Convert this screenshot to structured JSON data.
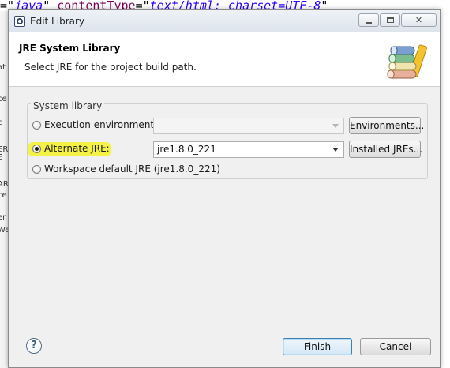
{
  "background": {
    "code_line": {
      "segments": [
        {
          "text": "=\"",
          "cls": "pl"
        },
        {
          "text": "java",
          "cls": "str"
        },
        {
          "text": "\" ",
          "cls": "pl"
        },
        {
          "text": "contentType",
          "cls": "kw"
        },
        {
          "text": "=\"",
          "cls": "pl"
        },
        {
          "text": "text/html; charset=UTF-8",
          "cls": "str"
        },
        {
          "text": "\"",
          "cls": "pl"
        }
      ]
    },
    "side_fragments": [
      "at",
      "ce",
      "c",
      "ER",
      "E",
      "AR",
      "ce",
      "er",
      "We"
    ]
  },
  "dialog": {
    "title": "Edit Library",
    "window_buttons": {
      "minimize": "minimize",
      "maximize": "maximize",
      "close": "✕"
    },
    "header": {
      "title": "JRE System Library",
      "description": "Select JRE for the project build path.",
      "icon": "library-books-icon"
    },
    "group": {
      "label": "System library",
      "options": [
        {
          "label": "Execution environment:",
          "selected": false
        },
        {
          "label": "Alternate JRE:",
          "selected": true
        },
        {
          "label": "Workspace default JRE (jre1.8.0_221)",
          "selected": false
        }
      ],
      "execution_env_value": "",
      "alternate_jre_value": "jre1.8.0_221",
      "environments_button": "Environments...",
      "installed_jres_button": "Installed JREs..."
    },
    "footer": {
      "help_icon": "?",
      "finish_label": "Finish",
      "cancel_label": "Cancel"
    },
    "colors": {
      "highlight": "#f3f13c",
      "default_button_border": "#3c7fb1"
    }
  }
}
